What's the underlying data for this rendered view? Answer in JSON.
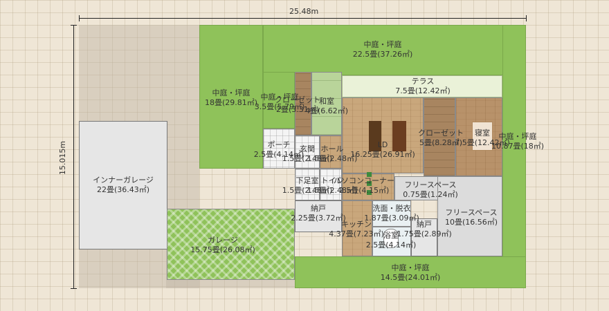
{
  "dimensions": {
    "width": "25.48m",
    "height": "15.015m"
  },
  "rooms": [
    {
      "name": "中庭・坪庭",
      "area": "22.5畳(37.26㎡)"
    },
    {
      "name": "テラス",
      "area": "7.5畳(12.42㎡)"
    },
    {
      "name": "中庭・坪庭",
      "area": "18畳(29.81㎡)"
    },
    {
      "name": "中庭・坪庭",
      "area": "3.5畳(5.79㎡)"
    },
    {
      "name": "クローゼット",
      "area": "2畳(3.31㎡)"
    },
    {
      "name": "和室",
      "area": "4畳(6.62㎡)"
    },
    {
      "name": "LD",
      "area": "16.25畳(26.91㎡)"
    },
    {
      "name": "クローゼット",
      "area": "5畳(8.28㎡)"
    },
    {
      "name": "寝室",
      "area": "7.5畳(12.42㎡)"
    },
    {
      "name": "中庭・坪庭",
      "area": "10.87畳(18㎡)"
    },
    {
      "name": "ポーチ",
      "area": "2.5畳(4.14㎡)"
    },
    {
      "name": "玄関",
      "area": "1.5畳(2.48㎡)"
    },
    {
      "name": "ホール",
      "area": "1.5畳(2.48㎡)"
    },
    {
      "name": "インナーガレージ",
      "area": "22畳(36.43㎡)"
    },
    {
      "name": "下足室",
      "area": "1.5畳(2.48㎡)"
    },
    {
      "name": "トイレ",
      "area": "1.5畳(2.48㎡)"
    },
    {
      "name": "パソコンコーナー",
      "area": "2.5畳(4.15㎡)"
    },
    {
      "name": "フリースペース",
      "area": "0.75畳(1.24㎡)"
    },
    {
      "name": "納戸",
      "area": "2.25畳(3.72㎡)"
    },
    {
      "name": "洗面・脱衣",
      "area": "1.87畳(3.09㎡)"
    },
    {
      "name": "フリースペース",
      "area": "10畳(16.56㎡)"
    },
    {
      "name": "ガレージ",
      "area": "15.75畳(26.08㎡)"
    },
    {
      "name": "キッチン",
      "area": "4.37畳(7.23㎡)"
    },
    {
      "name": "納戸",
      "area": "1.75畳(2.89㎡)"
    },
    {
      "name": "浴室",
      "area": "2.5畳(4.14㎡)"
    },
    {
      "name": "中庭・坪庭",
      "area": "14.5畳(24.01㎡)"
    }
  ]
}
